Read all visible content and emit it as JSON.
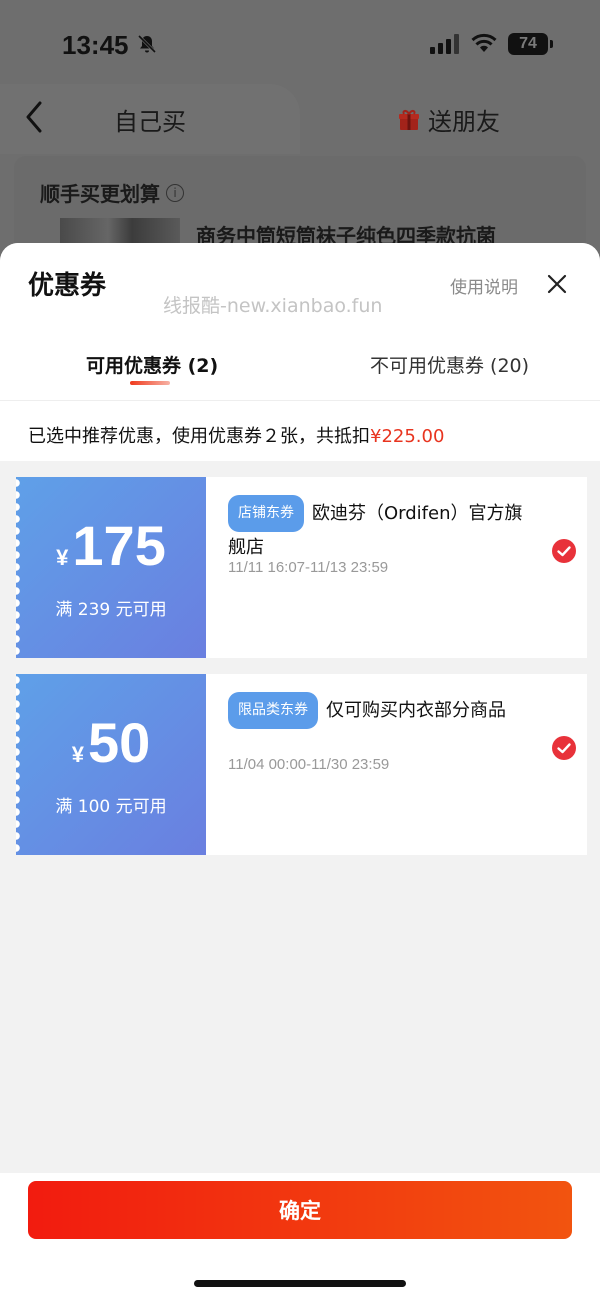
{
  "status_bar": {
    "time": "13:45",
    "battery": "74"
  },
  "background": {
    "tab_self": "自己买",
    "tab_gift": "送朋友",
    "upsell_title": "顺手买更划算",
    "info_symbol": "i",
    "product_name": "商务中筒短筒袜子纯色四季款抗菌"
  },
  "sheet": {
    "title": "优惠券",
    "watermark": "线报酷-new.xianbao.fun",
    "usage_link": "使用说明",
    "tab_available": "可用优惠券 (2)",
    "tab_unavailable": "不可用优惠券 (20)",
    "summary_prefix": "已选中推荐优惠，使用优惠券２张，共抵扣",
    "summary_amount": "¥225.00"
  },
  "coupons": [
    {
      "currency": "¥",
      "amount": "175",
      "condition": "满 239 元可用",
      "tag": "店铺东券",
      "name": "欧迪芬（Ordifen）官方旗舰店",
      "date": "11/11 16:07-11/13 23:59"
    },
    {
      "currency": "¥",
      "amount": "50",
      "condition": "满 100 元可用",
      "tag": "限品类东券",
      "name": "仅可购买内衣部分商品",
      "date": "11/04 00:00-11/30 23:59"
    }
  ],
  "confirm_label": "确定",
  "colors": {
    "accent": "#e8341f",
    "coupon_blue": "#5f94e6",
    "check_red": "#e8323a"
  }
}
